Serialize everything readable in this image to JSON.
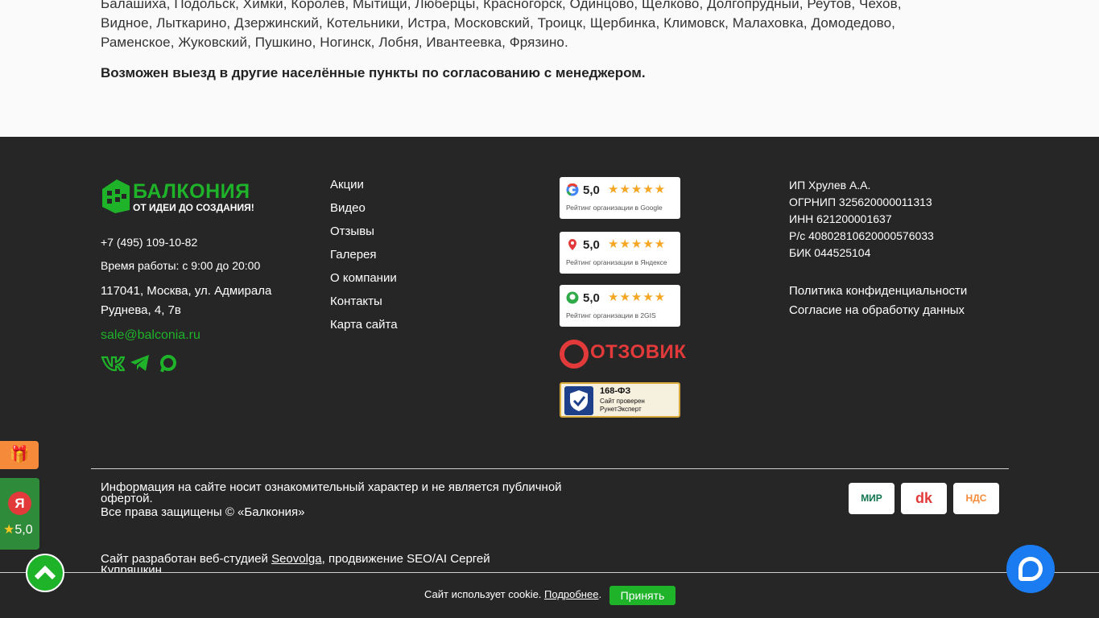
{
  "cities": {
    "line1": "Балашиха, Подольск, Химки, Королёв, Мытищи, Люберцы, Красногорск, Одинцово, Щёлково, Долгопрудный, Реутов, Чехов,",
    "line2": "Видное, Лыткарино, Дзержинский, Котельники, Истра, Московский, Троицк, Щербинка, Климовск, Малаховка, Домодедово,",
    "line3": "Раменское, Жуковский, Пушкино, Ногинск, Лобня, Ивантеевка, Фрязино.",
    "note": "Возможен выезд в другие населённые пункты по согласованию с менеджером."
  },
  "brand": {
    "name": "БАЛКОНИЯ",
    "slogan": "ОТ ИДЕИ ДО СОЗДАНИЯ!",
    "color": "#1fb32a"
  },
  "contacts": {
    "phone": "+7 (495) 109-10-82",
    "hours": "Время работы: с 9:00 до 20:00",
    "address": "117041, Москва, ул. Адмирала Руднева, 4, 7в",
    "email": "sale@balconia.ru",
    "socials": [
      "vk-icon",
      "telegram-icon",
      "max-icon"
    ]
  },
  "nav": [
    "Акции",
    "Видео",
    "Отзывы",
    "Галерея",
    "О компании",
    "Контакты",
    "Карта сайта"
  ],
  "ratings": [
    {
      "value": "5,0",
      "stars": "★★★★★",
      "caption": "Рейтинг организации в Google",
      "icon": "google-icon"
    },
    {
      "value": "5,0",
      "stars": "★★★★★",
      "caption": "Рейтинг организации в Яндексе",
      "icon": "yandex-maps-icon"
    },
    {
      "value": "5,0",
      "stars": "★★★★★",
      "caption": "Рейтинг организации в 2GIS",
      "icon": "2gis-icon"
    }
  ],
  "otzovik": "ОТЗОВИК",
  "fz": {
    "title": "168-ФЗ",
    "line1": "Сайт проверен",
    "line2": "РунетЭксперт"
  },
  "legal": {
    "ip": "ИП Хрулев А.А.",
    "ogrnip": "ОГРНИП 325620000011313",
    "inn": "ИНН 621200001637",
    "account": "Р/с 40802810620000576033",
    "bik": "БИК 044525104"
  },
  "policy": {
    "privacy": "Политика конфиденциальности",
    "consent": "Согласие на обработку данных"
  },
  "disclaimer": {
    "info": "Информация на сайте носит ознакомительный характер и не является публичной офертой.",
    "rights": "Все права защищены © «Балкония»"
  },
  "developer": {
    "prefix": "Сайт разработан веб-студией ",
    "studio": "Seovolga",
    "suffix": ", продвижение SEO/AI Сергей Купряшкин"
  },
  "payments": [
    "МИР",
    "dk",
    "НДС"
  ],
  "widgets": {
    "yandex_letter": "Я",
    "yandex_rating": "5,0"
  },
  "cookie": {
    "text": "Сайт использует cookie. ",
    "more": "Подробнее",
    "dot": ".",
    "accept": "Принять"
  }
}
